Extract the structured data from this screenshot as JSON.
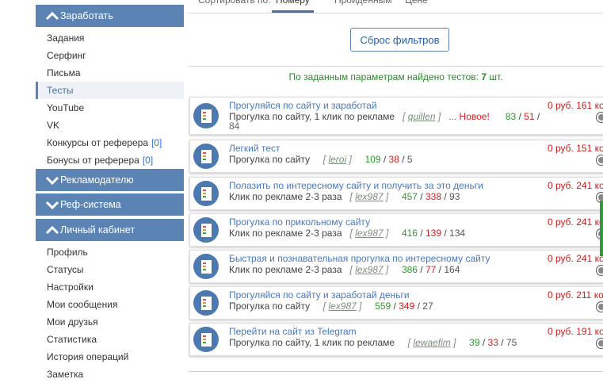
{
  "sidebar": {
    "earn": {
      "header": "Заработать",
      "items": [
        "Задания",
        "Серфинг",
        "Письма",
        "Тесты",
        "YouTube",
        "VK"
      ],
      "referrer_contests": {
        "label": "Конкурсы от реферера",
        "count": "[0]"
      },
      "referrer_bonuses": {
        "label": "Бонусы от реферера",
        "count": "[0]"
      }
    },
    "advertiser": {
      "header": "Рекламодателю"
    },
    "refsystem": {
      "header": "Реф-система"
    },
    "cabinet": {
      "header": "Личный кабинет",
      "items": [
        "Профиль",
        "Статусы",
        "Настройки",
        "Мои сообщения",
        "Мои друзья",
        "Статистика",
        "История операций",
        "Заметка"
      ]
    }
  },
  "main": {
    "tabs": [
      "Сортировать по:",
      "Номеру",
      "Пройденным",
      "Цене"
    ],
    "reset_label": "Сброс фильтров",
    "found_prefix": "По заданным параметрам найдено тестов:",
    "found_count": "7",
    "found_suffix": "шт.",
    "cards": [
      {
        "title": "Прогуляйся по сайту и заработай",
        "sub": "Прогулка по сайту, 1 клик по рекламе",
        "author": "quillen",
        "dots": "...",
        "new": "Новое!",
        "green": "83",
        "red": "51",
        "grey": "84",
        "price": "0 руб. 161 коп."
      },
      {
        "title": "Легкий тест",
        "sub": "Прогулка по сайту",
        "author": "leroi",
        "green": "109",
        "red": "38",
        "grey": "5",
        "price": "0 руб. 151 коп."
      },
      {
        "title": "Полазить по интересному сайту и получить за это деньги",
        "sub": "Клик по рекламе 2-3 раза",
        "author": "lex987",
        "green": "457",
        "red": "338",
        "grey": "93",
        "price": "0 руб. 241 коп."
      },
      {
        "title": "Прогулка по прикольному сайту",
        "sub": "Клик по рекламе 2-3 раза",
        "author": "lex987",
        "green": "416",
        "red": "139",
        "grey": "134",
        "price": "0 руб. 241 коп."
      },
      {
        "title": "Быстрая и познавательная прогулка по интересному сайту",
        "sub": "Клик по рекламе 2-3 раза",
        "author": "lex987",
        "green": "386",
        "red": "77",
        "grey": "164",
        "price": "0 руб. 241 коп."
      },
      {
        "title": "Прогуляйся по сайту и заработай деньги",
        "sub": "Прогулка по сайту",
        "author": "lex987",
        "green": "559",
        "red": "349",
        "grey": "27",
        "price": "0 руб. 211 коп."
      },
      {
        "title": "Перейти на сайт из Telegram",
        "sub": "Прогулка по сайту, 1 клик по рекламе",
        "author": "lewaefim",
        "green": "39",
        "red": "33",
        "grey": "75",
        "price": "0 руб. 191 коп."
      }
    ]
  },
  "colors": {
    "accent": "#5b84b5",
    "link": "#4a78c0",
    "green": "#2b9a2b",
    "red": "#d62020",
    "price": "#c62020"
  },
  "icons": [
    "chevron-up-icon",
    "chevron-down-icon",
    "test-doc-icon",
    "close-icon"
  ]
}
